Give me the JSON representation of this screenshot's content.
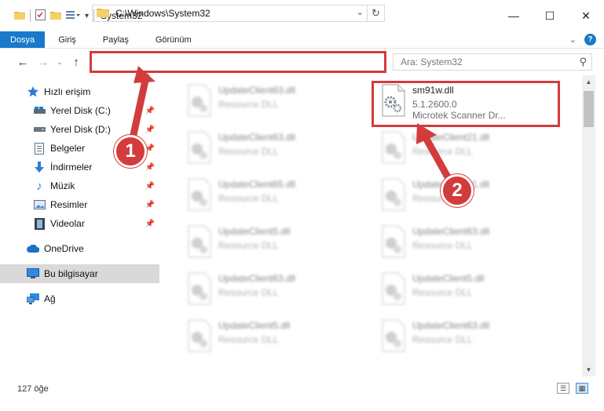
{
  "window": {
    "title": "System32",
    "minimize_glyph": "—",
    "maximize_glyph": "☐",
    "close_glyph": "✕"
  },
  "ribbon": {
    "tabs": [
      {
        "label": "Dosya",
        "active": true
      },
      {
        "label": "Giriş"
      },
      {
        "label": "Paylaş"
      },
      {
        "label": "Görünüm"
      }
    ],
    "help_label": "?"
  },
  "nav": {
    "address": "C:\\Windows\\System32",
    "search_placeholder": "Ara: System32"
  },
  "sidebar": {
    "items": [
      {
        "label": "Hızlı erişim",
        "icon": "star-icon"
      },
      {
        "label": "Yerel Disk (C:)",
        "icon": "drive-icon",
        "pinned": true
      },
      {
        "label": "Yerel Disk (D:)",
        "icon": "drive-icon",
        "pinned": true
      },
      {
        "label": "Belgeler",
        "icon": "document-icon",
        "pinned": true
      },
      {
        "label": "İndirmeler",
        "icon": "download-icon",
        "pinned": true
      },
      {
        "label": "Müzik",
        "icon": "music-icon",
        "pinned": true
      },
      {
        "label": "Resimler",
        "icon": "pictures-icon",
        "pinned": true
      },
      {
        "label": "Videolar",
        "icon": "video-icon",
        "pinned": true
      },
      {
        "label": "OneDrive",
        "icon": "cloud-icon"
      },
      {
        "label": "Bu bilgisayar",
        "icon": "computer-icon",
        "selected": true
      },
      {
        "label": "Ağ",
        "icon": "network-icon"
      }
    ]
  },
  "files": {
    "left_column": [
      {
        "name": "UpdateClient63.dll",
        "type": "Resource DLL"
      },
      {
        "name": "UpdateClient63.dll",
        "type": "Resource DLL"
      },
      {
        "name": "UpdateClient65.dll",
        "type": "Resource DLL"
      },
      {
        "name": "UpdateClient5.dll",
        "type": "Resource DLL"
      },
      {
        "name": "UpdateClient63.dll",
        "type": "Resource DLL"
      },
      {
        "name": "UpdateClient5.dll",
        "type": "Resource DLL"
      }
    ],
    "highlighted": {
      "name": "sm91w.dll",
      "version": "5.1.2600.0",
      "description": "Microtek Scanner Dr..."
    },
    "right_column": [
      {
        "name": "UpdateClient21.dll",
        "type": "Resource DLL"
      },
      {
        "name": "UpdateClient21.dll",
        "type": "Resource DLL"
      },
      {
        "name": "UpdateClient63.dll",
        "type": "Resource DLL"
      },
      {
        "name": "UpdateClient5.dll",
        "type": "Resource DLL"
      },
      {
        "name": "UpdateClient63.dll",
        "type": "Resource DLL"
      }
    ]
  },
  "status": {
    "item_count": "127 öğe"
  },
  "annotations": {
    "step1": "1",
    "step2": "2",
    "color": "#d23c3c"
  }
}
